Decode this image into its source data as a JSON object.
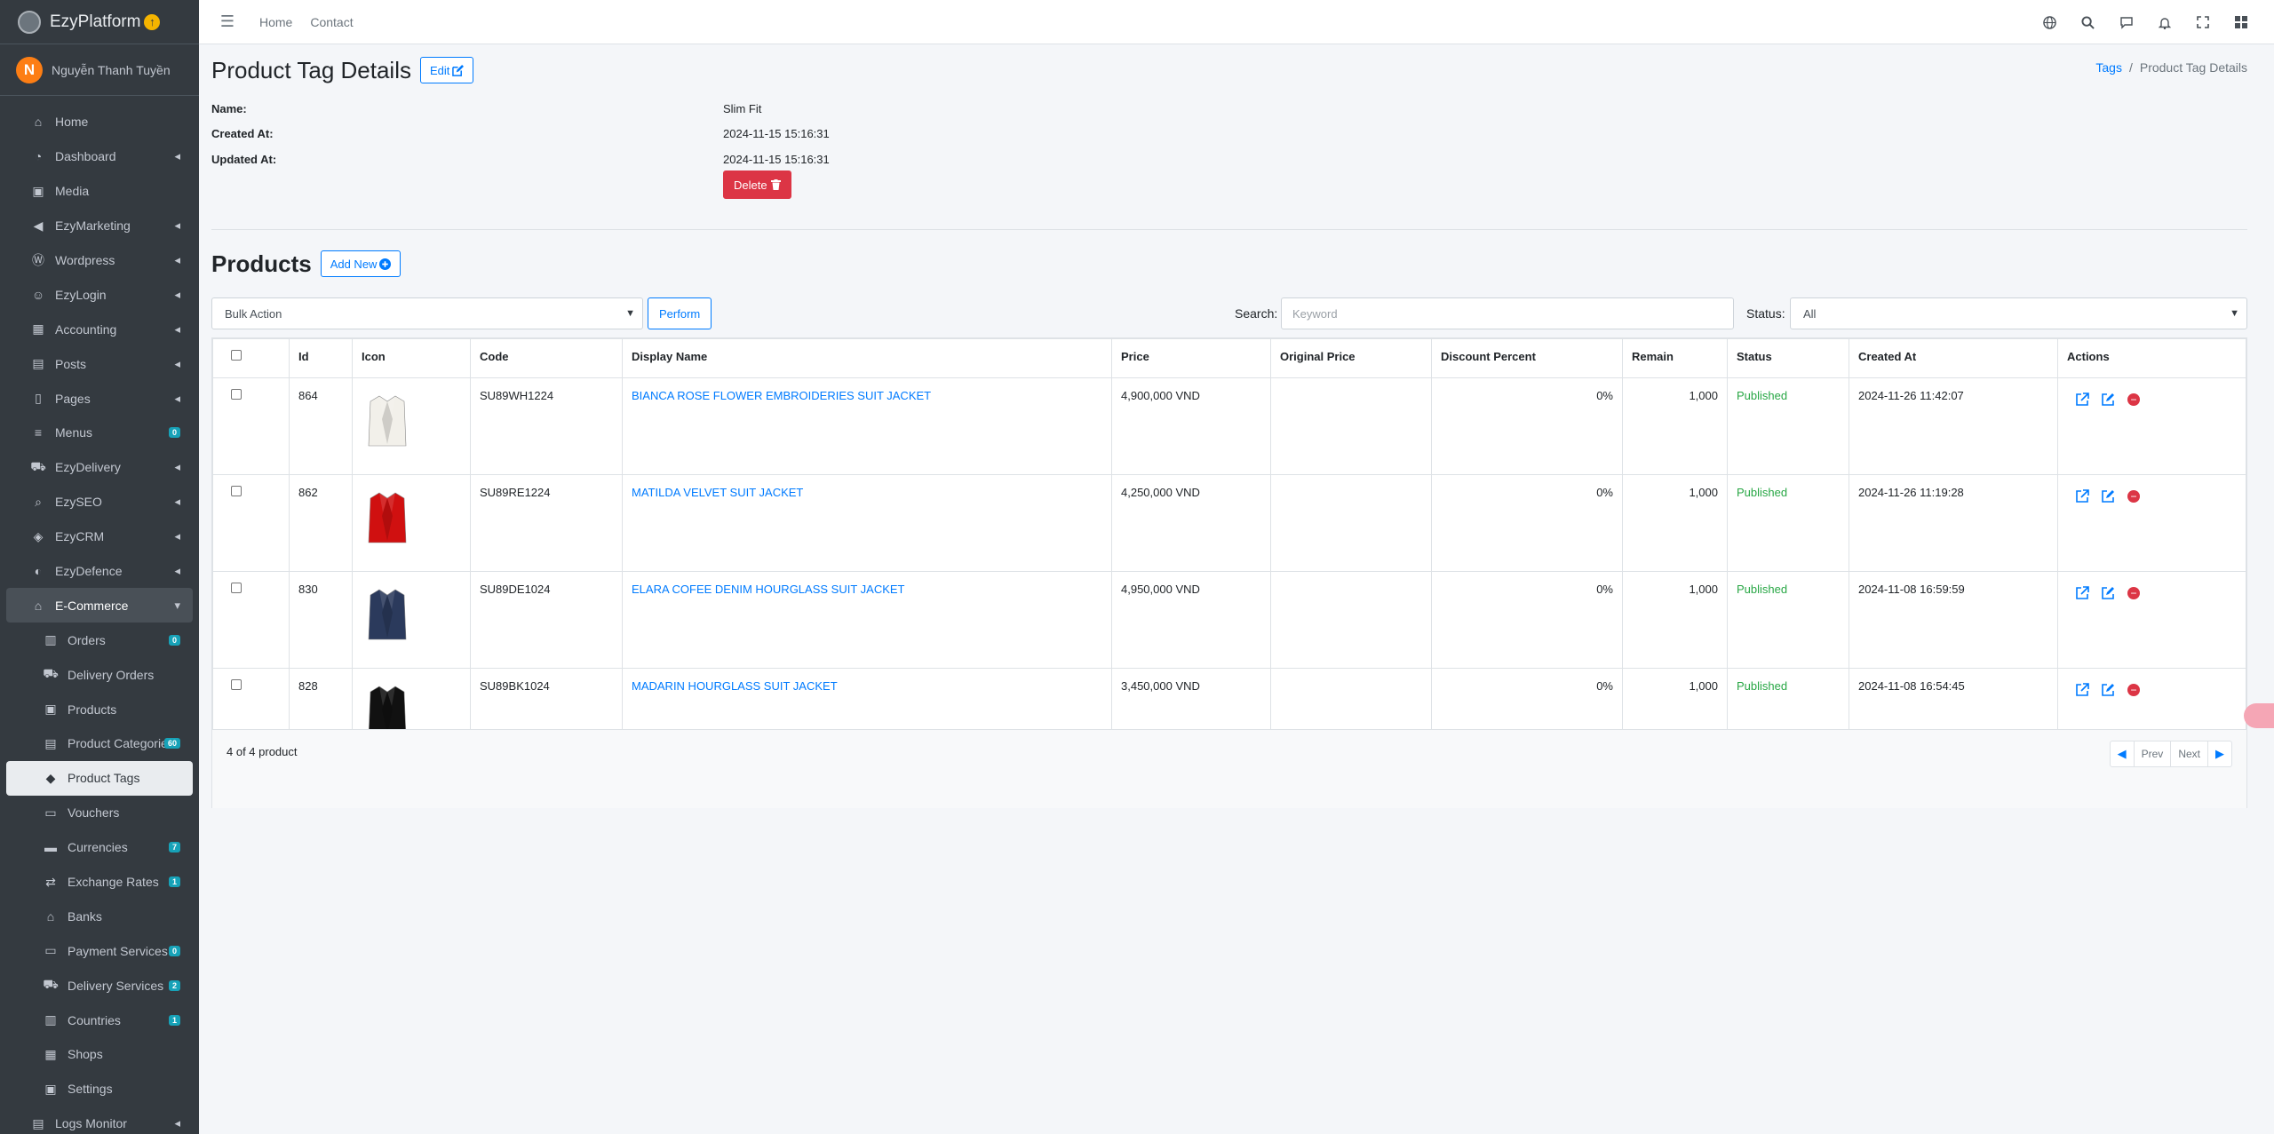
{
  "brand": {
    "name": "EzyPlatform",
    "badge": "↑"
  },
  "user": {
    "initial": "N",
    "name": "Nguyễn Thanh Tuyền"
  },
  "sidebar": {
    "items": [
      {
        "label": "Home",
        "icon": "home-icon",
        "glyph": "⌂",
        "chevron": false,
        "badge": ""
      },
      {
        "label": "Dashboard",
        "icon": "dashboard-icon",
        "glyph": "◔",
        "chevron": true,
        "badge": ""
      },
      {
        "label": "Media",
        "icon": "media-icon",
        "glyph": "▣",
        "chevron": false,
        "badge": ""
      },
      {
        "label": "EzyMarketing",
        "icon": "megaphone-icon",
        "glyph": "◀",
        "chevron": true,
        "badge": ""
      },
      {
        "label": "Wordpress",
        "icon": "wordpress-icon",
        "glyph": "Ⓦ",
        "chevron": true,
        "badge": ""
      },
      {
        "label": "EzyLogin",
        "icon": "user-login-icon",
        "glyph": "☺",
        "chevron": true,
        "badge": ""
      },
      {
        "label": "Accounting",
        "icon": "accounting-icon",
        "glyph": "▦",
        "chevron": true,
        "badge": ""
      },
      {
        "label": "Posts",
        "icon": "posts-icon",
        "glyph": "▤",
        "chevron": true,
        "badge": ""
      },
      {
        "label": "Pages",
        "icon": "pages-icon",
        "glyph": "▯",
        "chevron": true,
        "badge": ""
      },
      {
        "label": "Menus",
        "icon": "menus-icon",
        "glyph": "≡",
        "chevron": false,
        "badge": "0"
      },
      {
        "label": "EzyDelivery",
        "icon": "truck-icon",
        "glyph": "⛟",
        "chevron": true,
        "badge": ""
      },
      {
        "label": "EzySEO",
        "icon": "seo-icon",
        "glyph": "⌕",
        "chevron": true,
        "badge": ""
      },
      {
        "label": "EzyCRM",
        "icon": "handshake-icon",
        "glyph": "◈",
        "chevron": true,
        "badge": ""
      },
      {
        "label": "EzyDefence",
        "icon": "shield-icon",
        "glyph": "◐",
        "chevron": true,
        "badge": ""
      },
      {
        "label": "E-Commerce",
        "icon": "store-icon",
        "glyph": "⌂",
        "chevron": true,
        "badge": "",
        "open": true
      },
      {
        "label": "Orders",
        "icon": "orders-icon",
        "glyph": "▥",
        "chevron": false,
        "badge": "0",
        "sub": true
      },
      {
        "label": "Delivery Orders",
        "icon": "delivery-orders-icon",
        "glyph": "⛟",
        "chevron": false,
        "badge": "",
        "sub": true
      },
      {
        "label": "Products",
        "icon": "products-icon",
        "glyph": "▣",
        "chevron": false,
        "badge": "",
        "sub": true
      },
      {
        "label": "Product Categories",
        "icon": "categories-icon",
        "glyph": "▤",
        "chevron": false,
        "badge": "60",
        "sub": true
      },
      {
        "label": "Product Tags",
        "icon": "tags-icon",
        "glyph": "◆",
        "chevron": false,
        "badge": "",
        "sub": true,
        "active": true
      },
      {
        "label": "Vouchers",
        "icon": "voucher-icon",
        "glyph": "▭",
        "chevron": false,
        "badge": "",
        "sub": true
      },
      {
        "label": "Currencies",
        "icon": "currency-icon",
        "glyph": "▬",
        "chevron": false,
        "badge": "7",
        "sub": true
      },
      {
        "label": "Exchange Rates",
        "icon": "exchange-icon",
        "glyph": "⇄",
        "chevron": false,
        "badge": "1",
        "sub": true
      },
      {
        "label": "Banks",
        "icon": "bank-icon",
        "glyph": "⌂",
        "chevron": false,
        "badge": "",
        "sub": true
      },
      {
        "label": "Payment Services",
        "icon": "payment-icon",
        "glyph": "▭",
        "chevron": false,
        "badge": "0",
        "sub": true
      },
      {
        "label": "Delivery Services",
        "icon": "truck-icon",
        "glyph": "⛟",
        "chevron": false,
        "badge": "2",
        "sub": true
      },
      {
        "label": "Countries",
        "icon": "globe-icon",
        "glyph": "▥",
        "chevron": false,
        "badge": "1",
        "sub": true
      },
      {
        "label": "Shops",
        "icon": "shop-icon",
        "glyph": "▦",
        "chevron": false,
        "badge": "",
        "sub": true
      },
      {
        "label": "Settings",
        "icon": "settings-icon",
        "glyph": "▣",
        "chevron": false,
        "badge": "",
        "sub": true
      },
      {
        "label": "Logs Monitor",
        "icon": "logs-icon",
        "glyph": "▤",
        "chevron": true,
        "badge": ""
      }
    ]
  },
  "topbar": {
    "links": [
      "Home",
      "Contact"
    ],
    "icons": [
      "globe-icon",
      "search-icon",
      "messages-icon",
      "bell-icon",
      "fullscreen-icon",
      "apps-grid-icon"
    ]
  },
  "page": {
    "title": "Product Tag Details",
    "edit_label": "Edit",
    "breadcrumb": {
      "parent": "Tags",
      "current": "Product Tag Details"
    }
  },
  "details": {
    "name_label": "Name:",
    "name": "Slim Fit",
    "created_label": "Created At:",
    "created": "2024-11-15 15:16:31",
    "updated_label": "Updated At:",
    "updated": "2024-11-15 15:16:31",
    "delete_label": "Delete"
  },
  "products": {
    "title": "Products",
    "add_new_label": "Add New",
    "bulk_action": "Bulk Action",
    "perform_label": "Perform",
    "search_label": "Search:",
    "search_placeholder": "Keyword",
    "status_label": "Status:",
    "status_value": "All",
    "columns": [
      "Id",
      "Icon",
      "Code",
      "Display Name",
      "Price",
      "Original Price",
      "Discount Percent",
      "Remain",
      "Status",
      "Created At",
      "Actions"
    ],
    "rows": [
      {
        "id": "864",
        "code": "SU89WH1224",
        "name": "BIANCA ROSE FLOWER EMBROIDERIES SUIT JACKET",
        "price": "4,900,000 VND",
        "original_price": "",
        "discount": "0%",
        "remain": "1,000",
        "status": "Published",
        "created": "2024-11-26 11:42:07",
        "color": "#f2f0ea"
      },
      {
        "id": "862",
        "code": "SU89RE1224",
        "name": "MATILDA VELVET SUIT JACKET",
        "price": "4,250,000 VND",
        "original_price": "",
        "discount": "0%",
        "remain": "1,000",
        "status": "Published",
        "created": "2024-11-26 11:19:28",
        "color": "#d01010"
      },
      {
        "id": "830",
        "code": "SU89DE1024",
        "name": "ELARA COFEE DENIM HOURGLASS SUIT JACKET",
        "price": "4,950,000 VND",
        "original_price": "",
        "discount": "0%",
        "remain": "1,000",
        "status": "Published",
        "created": "2024-11-08 16:59:59",
        "color": "#2b3a5c"
      },
      {
        "id": "828",
        "code": "SU89BK1024",
        "name": "MADARIN HOURGLASS SUIT JACKET",
        "price": "3,450,000 VND",
        "original_price": "",
        "discount": "0%",
        "remain": "1,000",
        "status": "Published",
        "created": "2024-11-08 16:54:45",
        "color": "#111111"
      }
    ],
    "footer": "4 of 4 product",
    "pager": {
      "prev": "Prev",
      "next": "Next"
    }
  },
  "colors": {
    "primary": "#007bff",
    "danger": "#dc3545",
    "success": "#28a745",
    "sidebar": "#343a40"
  }
}
